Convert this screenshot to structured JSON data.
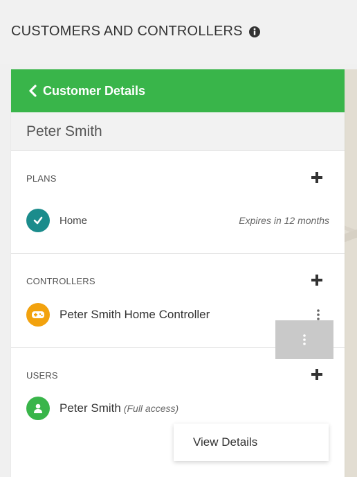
{
  "header": {
    "title": "CUSTOMERS AND CONTROLLERS",
    "info_icon": "info-circle-icon"
  },
  "panel": {
    "back_label": "Customer Details",
    "customer_name": "Peter Smith",
    "accent_color": "#39b54a"
  },
  "plans": {
    "label": "PLANS",
    "items": [
      {
        "name": "Home",
        "status": "Expires in 12 months",
        "icon": "check-icon",
        "color": "#1b8c8c"
      }
    ]
  },
  "controllers": {
    "label": "CONTROLLERS",
    "items": [
      {
        "name": "Peter Smith Home Controller",
        "icon": "controller-icon",
        "color": "#f2a20e"
      }
    ]
  },
  "users": {
    "label": "USERS",
    "items": [
      {
        "name": "Peter Smith",
        "access": "(Full access)",
        "icon": "user-icon",
        "color": "#39b54a"
      }
    ]
  },
  "menu": {
    "items": [
      "View Details"
    ]
  }
}
